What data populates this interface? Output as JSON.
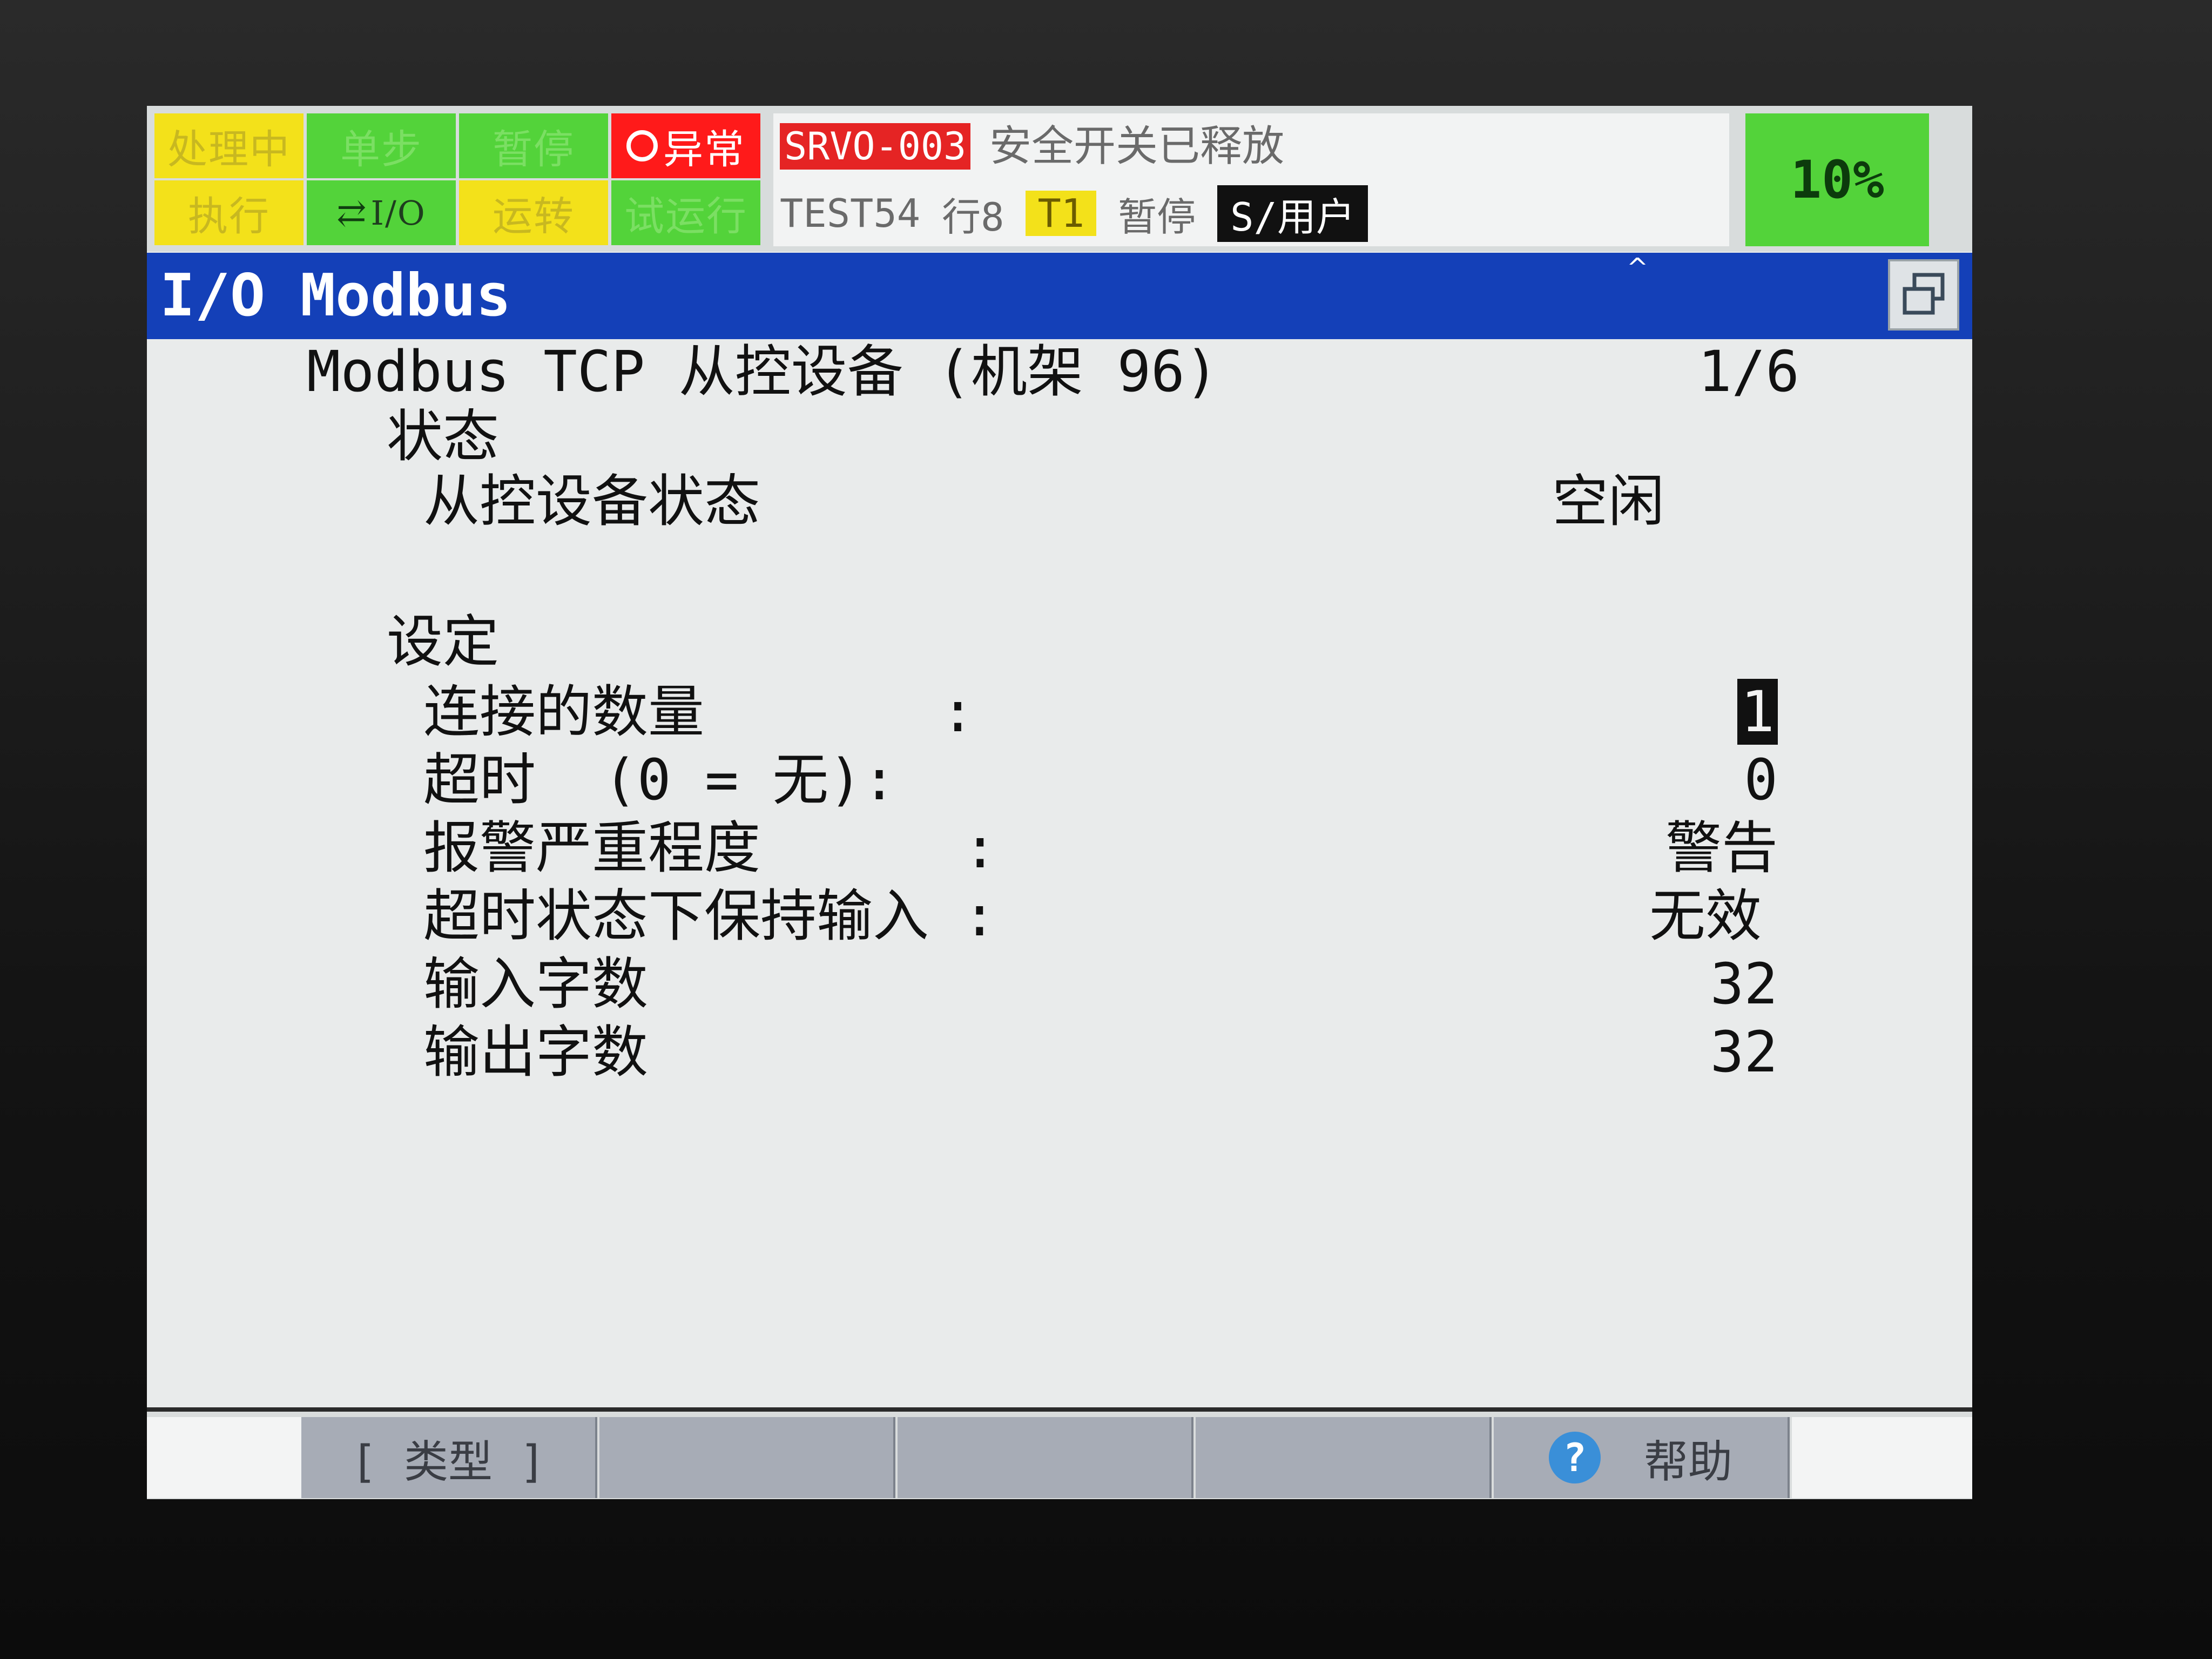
{
  "status_indicators": {
    "busy": "处理中",
    "step": "单步",
    "hold": "暂停",
    "fault": "异常",
    "run": "执行",
    "io": "I/O",
    "prod": "运转",
    "tcyc": "试运行"
  },
  "alarm": {
    "code": "SRVO-003",
    "message": "安全开关已释放"
  },
  "program": {
    "name": "TEST54",
    "line": "行8",
    "mode": "T1",
    "state": "暂停",
    "user": "S/用户"
  },
  "speed_override": "10%",
  "screen_title": "I/O Modbus",
  "heading": {
    "text": "Modbus TCP 从控设备 (机架 96)",
    "page": "1/6"
  },
  "status_section": {
    "label": "状态",
    "slave_status_label": "从控设备状态",
    "slave_status_value": "空闲"
  },
  "settings_section": {
    "label": "设定",
    "rows": [
      {
        "label": "连接的数量       :",
        "value": "1"
      },
      {
        "label": "超时  (0 = 无):",
        "value": "0"
      },
      {
        "label": "报警严重程度      :",
        "value": "警告"
      },
      {
        "label": "超时状态下保持输入 :",
        "value": "无效"
      },
      {
        "label": "输入字数",
        "value": "32"
      },
      {
        "label": "输出字数",
        "value": "32"
      }
    ]
  },
  "function_keys": {
    "f1": "[ 类型 ]",
    "f2": "",
    "f3": "",
    "f4": "",
    "f5": "帮助"
  },
  "colors": {
    "title_bar": "#1440b8",
    "indicator_yellow": "#f3e11a",
    "indicator_green": "#53d33a",
    "alarm_red": "#e52424"
  }
}
